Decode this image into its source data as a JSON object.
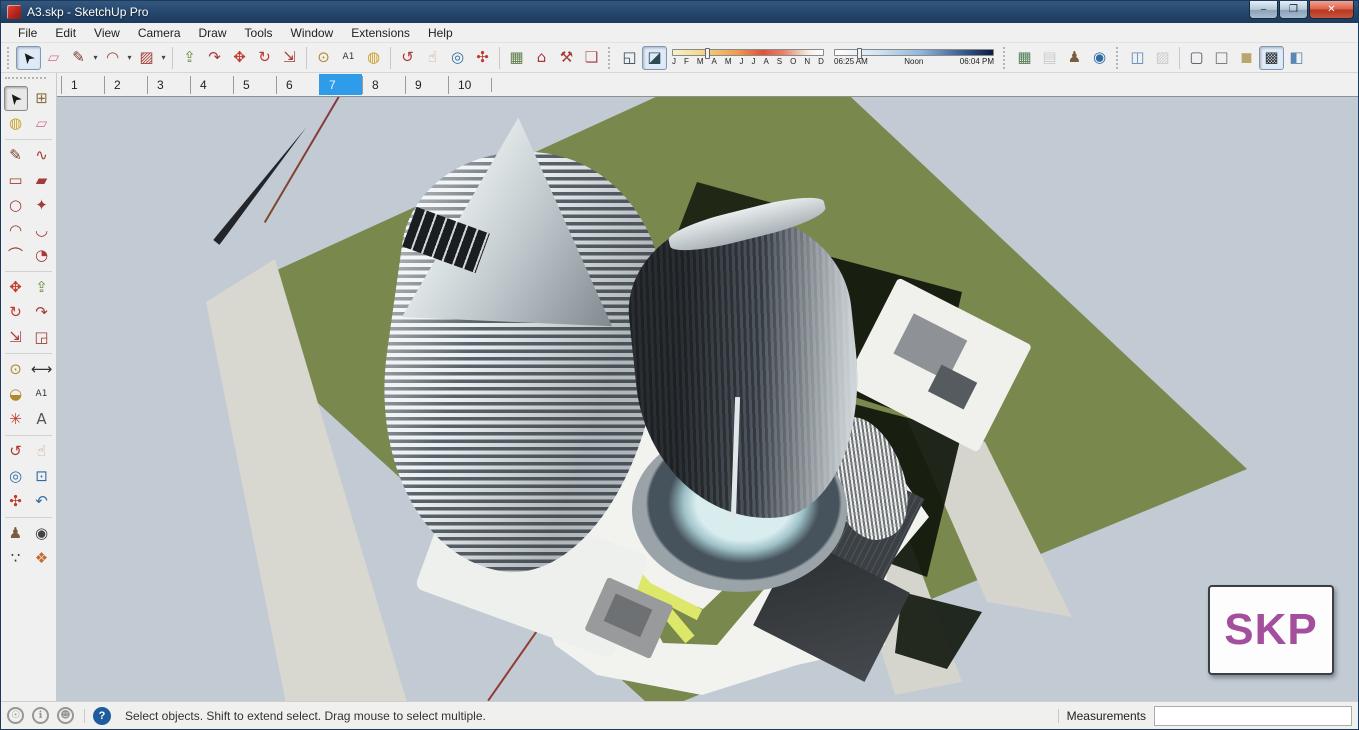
{
  "window": {
    "title": "A3.skp - SketchUp Pro",
    "buttons": [
      {
        "name": "minimize-button",
        "glyph": "–"
      },
      {
        "name": "restore-button",
        "glyph": "❐"
      },
      {
        "name": "close-button",
        "glyph": "✕",
        "close": true
      }
    ]
  },
  "menu": {
    "items": [
      "File",
      "Edit",
      "View",
      "Camera",
      "Draw",
      "Tools",
      "Window",
      "Extensions",
      "Help"
    ]
  },
  "toolbar": {
    "groups": [
      {
        "type": "grip"
      },
      {
        "type": "buttons",
        "buttons": [
          {
            "name": "select-tool",
            "glyph": "➤",
            "color": "#1a1a1a",
            "pressed": true,
            "rotate": -128
          },
          {
            "name": "eraser-tool",
            "glyph": "▱",
            "color": "#d4788a"
          },
          {
            "name": "line-tool",
            "glyph": "✎",
            "color": "#7a3b2e",
            "dropdown": true
          },
          {
            "name": "arc-tool",
            "glyph": "◠",
            "color": "#a33c36",
            "dropdown": true
          },
          {
            "name": "rectangle-tool",
            "glyph": "▨",
            "color": "#a33c36",
            "dropdown": true
          }
        ]
      },
      {
        "type": "sep"
      },
      {
        "type": "buttons",
        "buttons": [
          {
            "name": "push-pull-tool",
            "glyph": "⇪",
            "color": "#6d8f46"
          },
          {
            "name": "follow-me-tool",
            "glyph": "↷",
            "color": "#a33c36"
          },
          {
            "name": "move-tool",
            "glyph": "✥",
            "color": "#c0392b"
          },
          {
            "name": "rotate-tool",
            "glyph": "↻",
            "color": "#c0392b"
          },
          {
            "name": "scale-tool",
            "glyph": "⇲",
            "color": "#a33c36"
          }
        ]
      },
      {
        "type": "sep"
      },
      {
        "type": "buttons",
        "buttons": [
          {
            "name": "tape-measure-tool",
            "glyph": "⊙",
            "color": "#b08a2e"
          },
          {
            "name": "text-tool",
            "glyph": "A1",
            "color": "#333333",
            "small": true
          },
          {
            "name": "paint-bucket-tool",
            "glyph": "◍",
            "color": "#c9a227"
          }
        ]
      },
      {
        "type": "sep"
      },
      {
        "type": "buttons",
        "buttons": [
          {
            "name": "orbit-tool",
            "glyph": "↺",
            "color": "#b03a30"
          },
          {
            "name": "pan-tool",
            "glyph": "☝",
            "color": "#caa07e"
          },
          {
            "name": "zoom-tool",
            "glyph": "◎",
            "color": "#2e6da4"
          },
          {
            "name": "zoom-extents-tool",
            "glyph": "✣",
            "color": "#c0392b"
          }
        ]
      },
      {
        "type": "sep"
      },
      {
        "type": "buttons",
        "buttons": [
          {
            "name": "scenes-image-button",
            "glyph": "▦",
            "color": "#5e7d4a"
          },
          {
            "name": "3d-warehouse-button",
            "glyph": "⌂",
            "color": "#a33c36"
          },
          {
            "name": "extension-warehouse-button",
            "glyph": "⚒",
            "color": "#a33c36"
          },
          {
            "name": "send-to-layout-button",
            "glyph": "❏",
            "color": "#b05050"
          }
        ]
      },
      {
        "type": "grip"
      },
      {
        "type": "buttons",
        "buttons": [
          {
            "name": "shadow-settings-button",
            "glyph": "◱",
            "color": "#2f4858"
          },
          {
            "name": "toggle-shadows-button",
            "glyph": "◪",
            "color": "#2f4858",
            "pressed": true
          }
        ]
      },
      {
        "type": "date-slider"
      },
      {
        "type": "time-slider"
      },
      {
        "type": "grip"
      },
      {
        "type": "buttons",
        "buttons": [
          {
            "name": "add-location-button",
            "glyph": "▦",
            "color": "#4e7d52"
          },
          {
            "name": "toggle-terrain-button",
            "glyph": "▤",
            "color": "#9aa0a6",
            "disabled": true
          },
          {
            "name": "photo-textures-button",
            "glyph": "♟",
            "color": "#7a5c3e"
          },
          {
            "name": "google-earth-button",
            "glyph": "◉",
            "color": "#2e6da4"
          }
        ]
      },
      {
        "type": "grip"
      },
      {
        "type": "buttons",
        "buttons": [
          {
            "name": "xray-style-button",
            "glyph": "◫",
            "color": "#5b87b5"
          },
          {
            "name": "back-edges-style-button",
            "glyph": "▨",
            "color": "#9aa0a6",
            "disabled": true
          }
        ]
      },
      {
        "type": "sep"
      },
      {
        "type": "buttons",
        "buttons": [
          {
            "name": "wireframe-style-button",
            "glyph": "▢",
            "color": "#4a5560"
          },
          {
            "name": "hidden-line-style-button",
            "glyph": "□",
            "color": "#6a7076"
          },
          {
            "name": "shaded-style-button",
            "glyph": "◼",
            "color": "#b8a66e"
          },
          {
            "name": "shaded-with-textures-style-button",
            "glyph": "▩",
            "color": "#2b2f33",
            "pressed": true
          },
          {
            "name": "monochrome-style-button",
            "glyph": "◧",
            "color": "#5b87b5"
          }
        ]
      }
    ],
    "shadows": {
      "months": [
        "J",
        "F",
        "M",
        "A",
        "M",
        "J",
        "J",
        "A",
        "S",
        "O",
        "N",
        "D"
      ],
      "date_handle_pct": 21,
      "time_start": "06:25 AM",
      "time_mid": "Noon",
      "time_end": "06:04 PM",
      "time_handle_pct": 14
    }
  },
  "scene_tabs": {
    "tabs": [
      "1",
      "2",
      "3",
      "4",
      "5",
      "6",
      "7",
      "8",
      "9",
      "10"
    ],
    "active": "7",
    "active_color": "#2f9ce9"
  },
  "palette": {
    "rows": [
      {
        "type": "row",
        "cells": [
          {
            "name": "select-tool",
            "glyph": "➤",
            "color": "#1a1a1a",
            "pressed": true,
            "rotate": -128
          },
          {
            "name": "make-component-tool",
            "glyph": "⊞",
            "color": "#8a6d3b"
          }
        ]
      },
      {
        "type": "row",
        "cells": [
          {
            "name": "paint-bucket-tool",
            "glyph": "◍",
            "color": "#c9a227"
          },
          {
            "name": "eraser-tool",
            "glyph": "▱",
            "color": "#d4788a"
          }
        ]
      },
      {
        "type": "sep"
      },
      {
        "type": "row",
        "cells": [
          {
            "name": "line-tool",
            "glyph": "✎",
            "color": "#7a3b2e"
          },
          {
            "name": "freehand-tool",
            "glyph": "∿",
            "color": "#a33c36"
          }
        ]
      },
      {
        "type": "row",
        "cells": [
          {
            "name": "rectangle-tool",
            "glyph": "▭",
            "color": "#a33c36"
          },
          {
            "name": "rotated-rectangle-tool",
            "glyph": "▰",
            "color": "#a33c36"
          }
        ]
      },
      {
        "type": "row",
        "cells": [
          {
            "name": "circle-tool",
            "glyph": "○",
            "color": "#a33c36"
          },
          {
            "name": "polygon-tool",
            "glyph": "✦",
            "color": "#a33c36"
          }
        ]
      },
      {
        "type": "row",
        "cells": [
          {
            "name": "arc-tool",
            "glyph": "◠",
            "color": "#a33c36"
          },
          {
            "name": "two-point-arc-tool",
            "glyph": "◡",
            "color": "#a33c36"
          }
        ]
      },
      {
        "type": "row",
        "cells": [
          {
            "name": "three-point-arc-tool",
            "glyph": "⌒",
            "color": "#a33c36"
          },
          {
            "name": "pie-tool",
            "glyph": "◔",
            "color": "#a33c36"
          }
        ]
      },
      {
        "type": "sep"
      },
      {
        "type": "row",
        "cells": [
          {
            "name": "move-tool",
            "glyph": "✥",
            "color": "#c0392b"
          },
          {
            "name": "push-pull-tool",
            "glyph": "⇪",
            "color": "#6d8f46"
          }
        ]
      },
      {
        "type": "row",
        "cells": [
          {
            "name": "rotate-tool",
            "glyph": "↻",
            "color": "#c0392b"
          },
          {
            "name": "follow-me-tool",
            "glyph": "↷",
            "color": "#a33c36"
          }
        ]
      },
      {
        "type": "row",
        "cells": [
          {
            "name": "scale-tool",
            "glyph": "⇲",
            "color": "#a33c36"
          },
          {
            "name": "offset-tool",
            "glyph": "◲",
            "color": "#a33c36"
          }
        ]
      },
      {
        "type": "sep"
      },
      {
        "type": "row",
        "cells": [
          {
            "name": "tape-measure-tool",
            "glyph": "⊙",
            "color": "#b08a2e"
          },
          {
            "name": "dimension-tool",
            "glyph": "⟷",
            "color": "#333333"
          }
        ]
      },
      {
        "type": "row",
        "cells": [
          {
            "name": "protractor-tool",
            "glyph": "◒",
            "color": "#b08a2e"
          },
          {
            "name": "text-tool",
            "glyph": "A1",
            "color": "#333333",
            "small": true
          }
        ]
      },
      {
        "type": "row",
        "cells": [
          {
            "name": "axes-tool",
            "glyph": "✳",
            "color": "#c0392b"
          },
          {
            "name": "3d-text-tool",
            "glyph": "A",
            "color": "#555555"
          }
        ]
      },
      {
        "type": "sep"
      },
      {
        "type": "row",
        "cells": [
          {
            "name": "orbit-tool",
            "glyph": "↺",
            "color": "#b03a30"
          },
          {
            "name": "pan-tool",
            "glyph": "☝",
            "color": "#caa07e"
          }
        ]
      },
      {
        "type": "row",
        "cells": [
          {
            "name": "zoom-tool",
            "glyph": "◎",
            "color": "#2e6da4"
          },
          {
            "name": "zoom-window-tool",
            "glyph": "⊡",
            "color": "#2e6da4"
          }
        ]
      },
      {
        "type": "row",
        "cells": [
          {
            "name": "zoom-extents-tool",
            "glyph": "✣",
            "color": "#c0392b"
          },
          {
            "name": "zoom-previous-tool",
            "glyph": "↶",
            "color": "#2e6da4"
          }
        ]
      },
      {
        "type": "sep"
      },
      {
        "type": "row",
        "cells": [
          {
            "name": "position-camera-tool",
            "glyph": "♟",
            "color": "#7a5c3e"
          },
          {
            "name": "look-around-tool",
            "glyph": "◉",
            "color": "#444444"
          }
        ]
      },
      {
        "type": "row",
        "cells": [
          {
            "name": "walk-tool",
            "glyph": "∵",
            "color": "#333333"
          },
          {
            "name": "section-plane-tool",
            "glyph": "❖",
            "color": "#c46a2e"
          }
        ]
      }
    ]
  },
  "viewport": {
    "watermark": "SKP",
    "colors": {
      "sky": "#c2cad4",
      "grass": "#79894e",
      "grass_shadow": "#10160b",
      "road": "#d8d7d0",
      "plaza": "#f2f3ef",
      "lime_accent": "#dde76a",
      "axis_red": "#8c3640",
      "watermark_purple": "#a44f9e"
    }
  },
  "statusbar": {
    "icons": [
      {
        "name": "geolocation-status-icon",
        "glyph": "☉"
      },
      {
        "name": "credits-status-icon",
        "glyph": "ℹ"
      },
      {
        "name": "user-status-icon",
        "glyph": "☻"
      }
    ],
    "help_glyph": "?",
    "hint": "Select objects. Shift to extend select. Drag mouse to select multiple.",
    "measurements_label": "Measurements",
    "measurements_value": ""
  }
}
